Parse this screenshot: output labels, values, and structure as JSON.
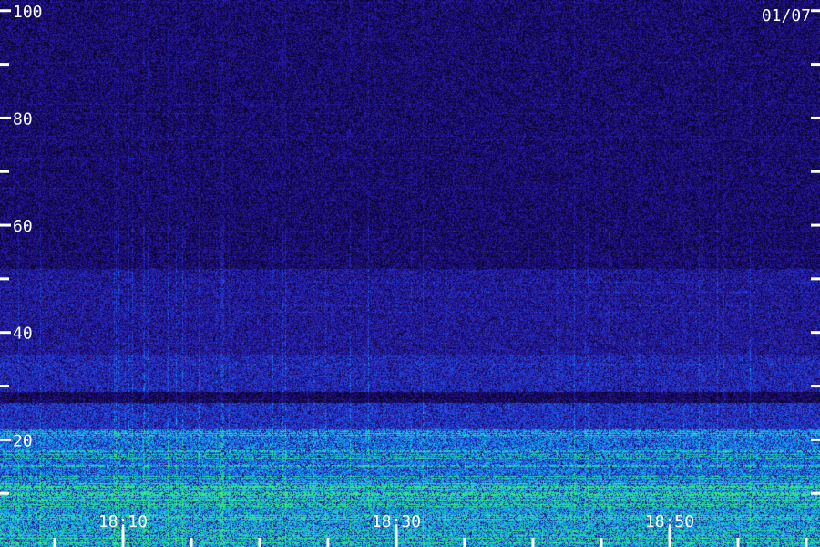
{
  "date_label": "01/07",
  "chart_data": {
    "type": "heatmap",
    "title": "",
    "xlabel": "",
    "ylabel": "",
    "ylim": [
      0,
      102
    ],
    "xlim": [
      "18:01",
      "19:01"
    ],
    "y_major_ticks": [
      20,
      40,
      60,
      80,
      100
    ],
    "y_minor_ticks": [
      10,
      30,
      50,
      70,
      90
    ],
    "y_tick_labels": [
      "20",
      "40",
      "60",
      "80",
      "100"
    ],
    "x_minor_ticks": [
      "18:05",
      "18:15",
      "18:20",
      "18:25",
      "18:35",
      "18:40",
      "18:45",
      "18:55",
      "19:00"
    ],
    "x_major_ticks": [
      "18:10",
      "18:30",
      "18:50"
    ],
    "x_tick_labels": [
      "18:10",
      "18:30",
      "18:50"
    ],
    "colormap": [
      "#000000",
      "#1a0a6e",
      "#2a1fb0",
      "#1f4fe6",
      "#12b8e8",
      "#3cf070"
    ],
    "intensity_profile": {
      "description_free": true,
      "bands": [
        {
          "y_from": 0,
          "y_to": 12,
          "level": 0.78
        },
        {
          "y_from": 12,
          "y_to": 22,
          "level": 0.68
        },
        {
          "y_from": 22,
          "y_to": 27,
          "level": 0.5
        },
        {
          "y_from": 27,
          "y_to": 29,
          "level": 0.2
        },
        {
          "y_from": 29,
          "y_to": 36,
          "level": 0.45
        },
        {
          "y_from": 36,
          "y_to": 52,
          "level": 0.36
        },
        {
          "y_from": 52,
          "y_to": 102,
          "level": 0.24
        }
      ]
    }
  }
}
